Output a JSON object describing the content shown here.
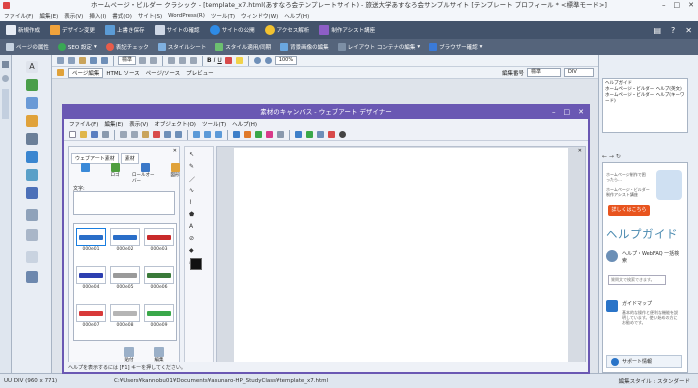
{
  "window": {
    "title": "ホームページ・ビルダー クラシック - [template_x7.html(あすなろ会テンプレートサイト) - 旅送大学あすなろ会サンプルサイト [テンプレート プロフィール * <標準モード>]",
    "menu": [
      "ファイル(F)",
      "編集(E)",
      "表示(V)",
      "挿入(I)",
      "書式(O)",
      "サイト(S)",
      "WordPress(R)",
      "ツール(T)",
      "ウィンドウ(W)",
      "ヘルプ(H)"
    ]
  },
  "toolbar1": {
    "items": [
      {
        "label": "新規作成",
        "color": "#e7ecf4"
      },
      {
        "label": "デザイン変更",
        "color": "#f0a33c"
      },
      {
        "label": "上書き保存",
        "color": "#5b9bd5"
      },
      {
        "label": "サイトの確認",
        "color": "#cfd8e6"
      },
      {
        "label": "サイトの公開",
        "color": "#2e8be6"
      },
      {
        "label": "アクセス解析",
        "color": "#f2c230"
      },
      {
        "label": "制作アシスト講座",
        "color": "#8d5ec6"
      }
    ]
  },
  "toolbar2": {
    "items": [
      {
        "label": "ページの属性",
        "color": "#c6d2e0"
      },
      {
        "label": "SEO 設定",
        "color": "#39a854"
      },
      {
        "label": "表記チェック",
        "color": "#e85c4a"
      },
      {
        "label": "スタイルシート",
        "color": "#7fb0e0"
      },
      {
        "label": "スタイル適用/同期",
        "color": "#6cc070"
      },
      {
        "label": "背景画像の編集",
        "color": "#6aa7e0"
      },
      {
        "label": "レイアウト コンテナの編集",
        "color": "#7d8fa5"
      },
      {
        "label": "ブラウザー確認",
        "color": "#3a7ad8"
      }
    ]
  },
  "editor": {
    "tabs": [
      "ページ編集",
      "HTML ソース",
      "ページ/ソース",
      "プレビュー"
    ],
    "font_select": "標準",
    "zoom": "100%",
    "style_select": "標準",
    "block_select": "DIV",
    "nav_select": "編集番号"
  },
  "help_panel": {
    "tree": [
      "ヘルプガイド",
      "ホームページ・ビルダー ヘルプ(英文)",
      "ホームページ・ビルダー ヘルプ(キーワード)"
    ],
    "nav": "← → ↻",
    "intro_note": "ホームページ制作で困ったら…",
    "intro_sub": "ホームページ・ビルダー 制作アシスト講座",
    "cta": "詳しくはこちら",
    "guide_title": "ヘルプガイド",
    "cards": [
      {
        "title": "ヘルプ・WebFAQ 一括検索",
        "desc": "",
        "color": "#6b8fb6"
      },
      {
        "title": "ガイドマップ",
        "desc": "基本的な操作と便利な機能を説明しています。使い始めの方にお勧めです。",
        "color": "#2a74c8"
      }
    ],
    "search_placeholder": "質問文で検索できます。",
    "support": "サポート情報"
  },
  "status": {
    "left": "UU  DIV (960 x 771)",
    "path": "C:¥Users¥kannobu01¥Documents¥asunaro-HP_StudyClass¥template_x7.html",
    "right": "編集スタイル : スタンダード"
  },
  "dialog": {
    "title": "素材のキャンバス - ウェブアート デザイナー",
    "menu": [
      "ファイル(F)",
      "編集(E)",
      "表示(V)",
      "オブジェクト(O)",
      "ツール(T)",
      "ヘルプ(H)"
    ],
    "tabs": [
      "ウェブアート素材",
      "素材"
    ],
    "categories": [
      {
        "label": "",
        "color": "#3a8ad8"
      },
      {
        "label": "ロゴ",
        "color": "#4f9e3f"
      },
      {
        "label": "ロールオーバー",
        "color": "#3a78c8"
      },
      {
        "label": "図形",
        "color": "#e0a23a"
      }
    ],
    "text_label": "文字:",
    "thumbs": [
      {
        "label": "000e01",
        "color": "#2a6ec8",
        "selected": true
      },
      {
        "label": "000e02",
        "color": "#2a6ec8",
        "selected": false
      },
      {
        "label": "000e03",
        "color": "#c82a2a",
        "selected": false
      },
      {
        "label": "000e04",
        "color": "#2d3fb0",
        "selected": false
      },
      {
        "label": "000e05",
        "color": "#9a9a9a",
        "selected": false
      },
      {
        "label": "000e06",
        "color": "#3a7a3a",
        "selected": false
      },
      {
        "label": "000e07",
        "color": "#d83a3a",
        "selected": false
      },
      {
        "label": "000e08",
        "color": "#b5b5b5",
        "selected": false
      },
      {
        "label": "000e09",
        "color": "#3aa84a",
        "selected": false
      }
    ],
    "footer_buttons": [
      "貼付",
      "編集"
    ],
    "status": "ヘルプを表示するには [F1] キーを押してください。"
  }
}
